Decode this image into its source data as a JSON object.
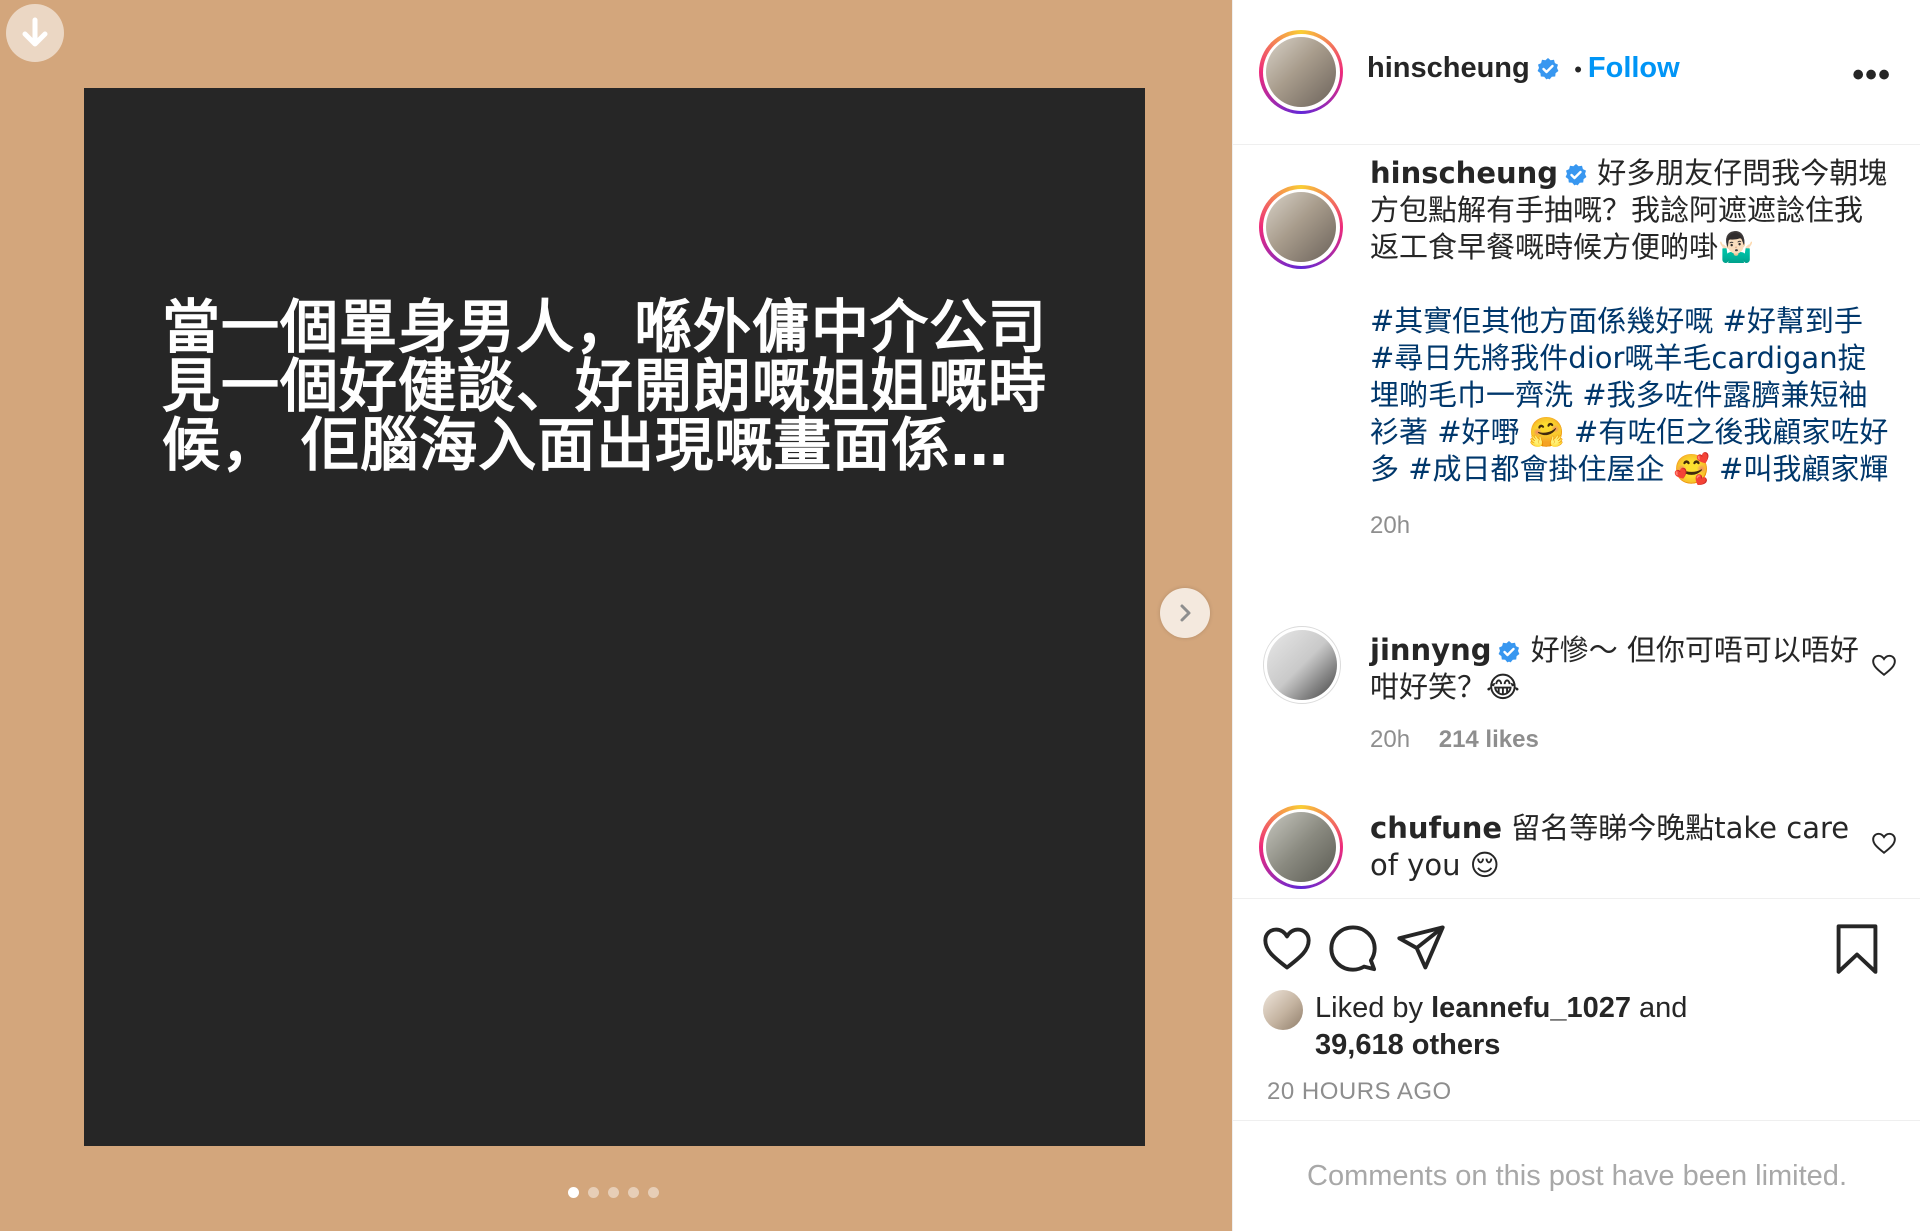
{
  "post": {
    "slide_text": "當一個單身男人，喺外傭中介公司見一個好健談、好開朗嘅姐姐嘅時候， 佢腦海入面出現嘅畫面係…",
    "carousel_count": 5,
    "carousel_active": 1
  },
  "header": {
    "username": "hinscheung",
    "dot": "•",
    "follow_label": "Follow",
    "more_label": "•••"
  },
  "caption": {
    "username": "hinscheung",
    "text": "好多朋友仔問我今朝塊方包點解有手抽嘅？我諗阿遮遮諗住我返工食早餐嘅時候方便啲啩🤷🏻‍♂️",
    "hashtags": "#其實佢其他方面係幾好嘅 #好幫到手 #尋日先將我件dior嘅羊毛cardigan掟埋啲毛巾一齊洗 #我多咗件露臍兼短袖衫著 #好嘢 🤗 #有咗佢之後我顧家咗好多 #成日都會掛住屋企 🥰 #叫我顧家輝",
    "time": "20h"
  },
  "comments": [
    {
      "username": "jinnyng",
      "verified": true,
      "text": "好慘～ 但你可唔可以唔好咁好笑？😂",
      "time": "20h",
      "likes": "214 likes"
    },
    {
      "username": "chufune",
      "verified": false,
      "text": "留名等睇今晚點take care of you 😌"
    }
  ],
  "likes": {
    "prefix": "Liked by",
    "user": "leannefu_1027",
    "and": "and",
    "others": "39,618 others"
  },
  "timeago": "20 HOURS AGO",
  "limited_notice": "Comments on this post have been limited.",
  "colors": {
    "media_background": "#d3a67c",
    "slide_background": "#262626",
    "follow_blue": "#0095f6",
    "hashtag_blue": "#00376b",
    "verified_blue": "#3897f0"
  }
}
